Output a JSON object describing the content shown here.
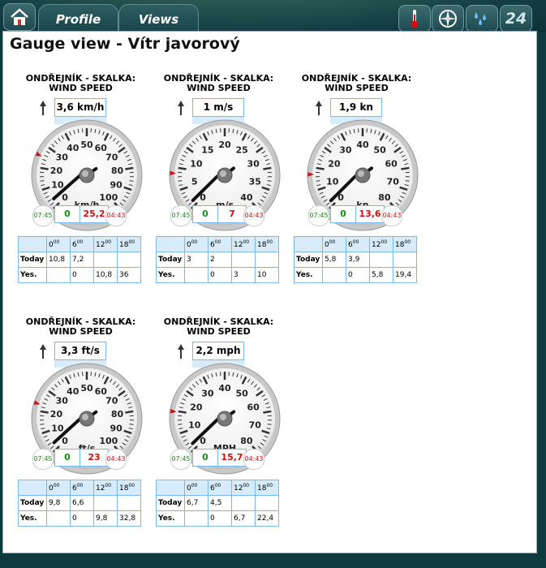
{
  "nav": {
    "tabs": [
      {
        "label": "Profile"
      },
      {
        "label": "Views"
      }
    ],
    "date_badge": "24"
  },
  "page": {
    "title": "Gauge view - Vítr javorový"
  },
  "gauges": [
    {
      "title_line1": "ONDŘEJNÍK - SKALKA:",
      "title_line2": "WIND SPEED",
      "value": "3,6 km/h",
      "unit": "km/h",
      "ticks": [
        0,
        10,
        20,
        30,
        40,
        50,
        60,
        70,
        80,
        90,
        100
      ],
      "needle_value": 3.6,
      "max_scale": 100,
      "min_value": "0",
      "max_value": "25,2",
      "time_min": "07:45",
      "time_max": "04:43",
      "hours": [
        "0",
        "6",
        "12",
        "18"
      ],
      "today": [
        "10,8",
        "7,2",
        "",
        ""
      ],
      "yes": [
        "",
        "0",
        "10,8",
        "36"
      ]
    },
    {
      "title_line1": "ONDŘEJNÍK - SKALKA:",
      "title_line2": "WIND SPEED",
      "value": "1 m/s",
      "unit": "m/s",
      "ticks": [
        0,
        5,
        10,
        15,
        20,
        25,
        30,
        35,
        40
      ],
      "needle_value": 1,
      "max_scale": 40,
      "min_value": "0",
      "max_value": "7",
      "time_min": "07:45",
      "time_max": "04:43",
      "hours": [
        "0",
        "6",
        "12",
        "18"
      ],
      "today": [
        "3",
        "2",
        "",
        ""
      ],
      "yes": [
        "",
        "0",
        "3",
        "10"
      ]
    },
    {
      "title_line1": "ONDŘEJNÍK - SKALKA:",
      "title_line2": "WIND SPEED",
      "value": "1,9 kn",
      "unit": "kn",
      "ticks": [
        0,
        10,
        20,
        30,
        40,
        50,
        60,
        70,
        80
      ],
      "needle_value": 1.9,
      "max_scale": 80,
      "min_value": "0",
      "max_value": "13,6",
      "time_min": "07:45",
      "time_max": "04:43",
      "hours": [
        "0",
        "6",
        "12",
        "18"
      ],
      "today": [
        "5,8",
        "3,9",
        "",
        ""
      ],
      "yes": [
        "",
        "0",
        "5,8",
        "19,4"
      ]
    },
    {
      "title_line1": "ONDŘEJNÍK - SKALKA:",
      "title_line2": "WIND SPEED",
      "value": "3,3 ft/s",
      "unit": "ft/s",
      "ticks": [
        0,
        10,
        20,
        30,
        40,
        50,
        60,
        70,
        80,
        90,
        100
      ],
      "needle_value": 3.3,
      "max_scale": 100,
      "min_value": "0",
      "max_value": "23",
      "time_min": "07:45",
      "time_max": "04:43",
      "hours": [
        "0",
        "6",
        "12",
        "18"
      ],
      "today": [
        "9,8",
        "6,6",
        "",
        ""
      ],
      "yes": [
        "",
        "0",
        "9,8",
        "32,8"
      ]
    },
    {
      "title_line1": "ONDŘEJNÍK - SKALKA:",
      "title_line2": "WIND SPEED",
      "value": "2,2 mph",
      "unit": "MPH",
      "ticks": [
        0,
        10,
        20,
        30,
        40,
        50,
        60,
        70,
        80
      ],
      "needle_value": 2.2,
      "max_scale": 80,
      "min_value": "0",
      "max_value": "15,7",
      "time_min": "07:45",
      "time_max": "04:43",
      "hours": [
        "0",
        "6",
        "12",
        "18"
      ],
      "today": [
        "6,7",
        "4,5",
        "",
        ""
      ],
      "yes": [
        "",
        "0",
        "6,7",
        "22,4"
      ]
    }
  ],
  "labels": {
    "today": "Today",
    "yes": "Yes.",
    "hour_suffix": "00"
  },
  "colors": {
    "accent_blue": "#7ab8e6",
    "min_green": "#1a8a1a",
    "max_red": "#d01010"
  }
}
